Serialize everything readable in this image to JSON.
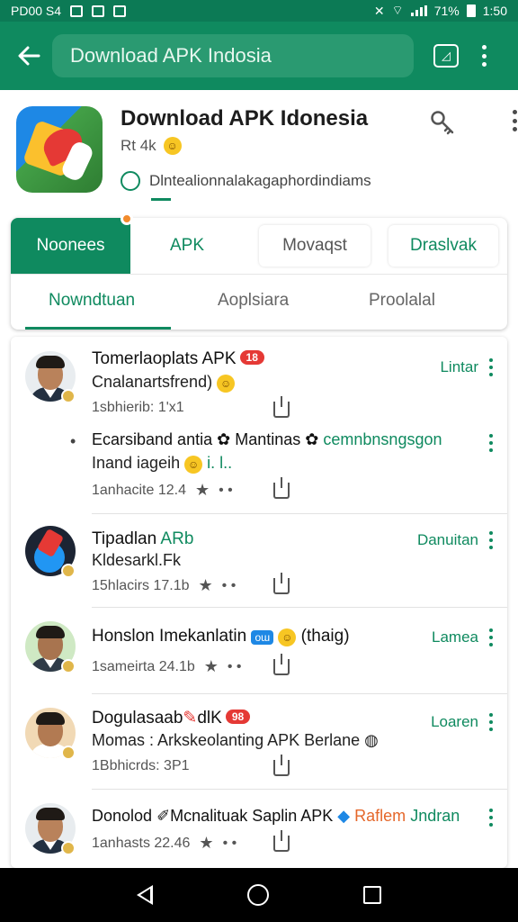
{
  "status_bar": {
    "left_text": "PD00 S4",
    "battery": "71%",
    "time": "1:50"
  },
  "app_bar": {
    "search_text": "Download APK Indosia"
  },
  "app": {
    "title": "Download APK Idonesia",
    "rating": "Rt 4k",
    "developer": "Dlntealionnalakagaphordindiams"
  },
  "tabs": [
    {
      "label": "Noonees"
    },
    {
      "label": "APK"
    },
    {
      "label": "Movaqst"
    },
    {
      "label": "Draslvak"
    }
  ],
  "subtabs": [
    {
      "label": "Nowndtuan"
    },
    {
      "label": "Aoplsiara"
    },
    {
      "label": "Proolalal"
    }
  ],
  "items": [
    {
      "title": "Tomerlaoplats APK",
      "badge": "18",
      "subtitle": "Cnalanartsfrend)",
      "meta": "1sbhierib: 1ʹx1",
      "action": "Lintar"
    },
    {
      "title": "Ecarsiband antia",
      "title_mid": "Mantinas",
      "title_end": "cemnbnsngsgon",
      "subtitle": "Inand iageih",
      "subtitle_end": "i. l..",
      "meta": "1anhacite 12.4",
      "action": ""
    },
    {
      "title": "Tipadlan",
      "title_green": "ARb",
      "subtitle": "Kldesarkl.Fk",
      "meta": "15hlacirs 17.1b",
      "action": "Danuitan"
    },
    {
      "title": "Honslon Imekanlatin",
      "title_end": "(thaig)",
      "meta": "1sameirta 24.1b",
      "action": "Lamea"
    },
    {
      "title": "Dogulasaab",
      "title_end": "dlK",
      "badge": "98",
      "subtitle": "Momas : Arkskeolanting APK Berlane",
      "meta": "1Bbhicrds: 3P1",
      "action": "Loaren"
    },
    {
      "title": "Donolod",
      "title_mid": "Mcnalituak Saplin APK",
      "title_orange": "Raflem",
      "title_end": "Jndran",
      "meta": "1anhasts 22.46"
    }
  ]
}
